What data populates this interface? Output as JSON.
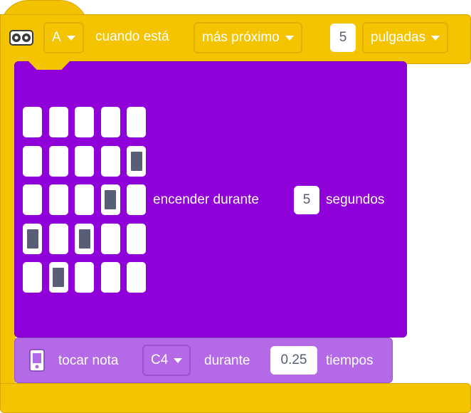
{
  "hat_block": {
    "sensor_icon": "distance-sensor-icon",
    "port": "A",
    "label_when": "cuando está",
    "comparison": "más próximo",
    "distance": "5",
    "unit": "pulgadas"
  },
  "light_block": {
    "matrix": [
      [
        0,
        0,
        0,
        0,
        0
      ],
      [
        0,
        0,
        0,
        0,
        1
      ],
      [
        0,
        0,
        0,
        1,
        0
      ],
      [
        1,
        0,
        1,
        0,
        0
      ],
      [
        0,
        1,
        0,
        0,
        0
      ]
    ],
    "label_on": "encender durante",
    "duration": "5",
    "label_unit": "segundos"
  },
  "sound_block": {
    "hub_icon": "hub-icon",
    "label_play": "tocar nota",
    "note": "C4",
    "label_for": "durante",
    "beats": "0.25",
    "label_unit": "tiempos"
  },
  "colors": {
    "events": "#f5c400",
    "light": "#9000d8",
    "sound": "#b469e6",
    "text_dark": "#575e75"
  }
}
